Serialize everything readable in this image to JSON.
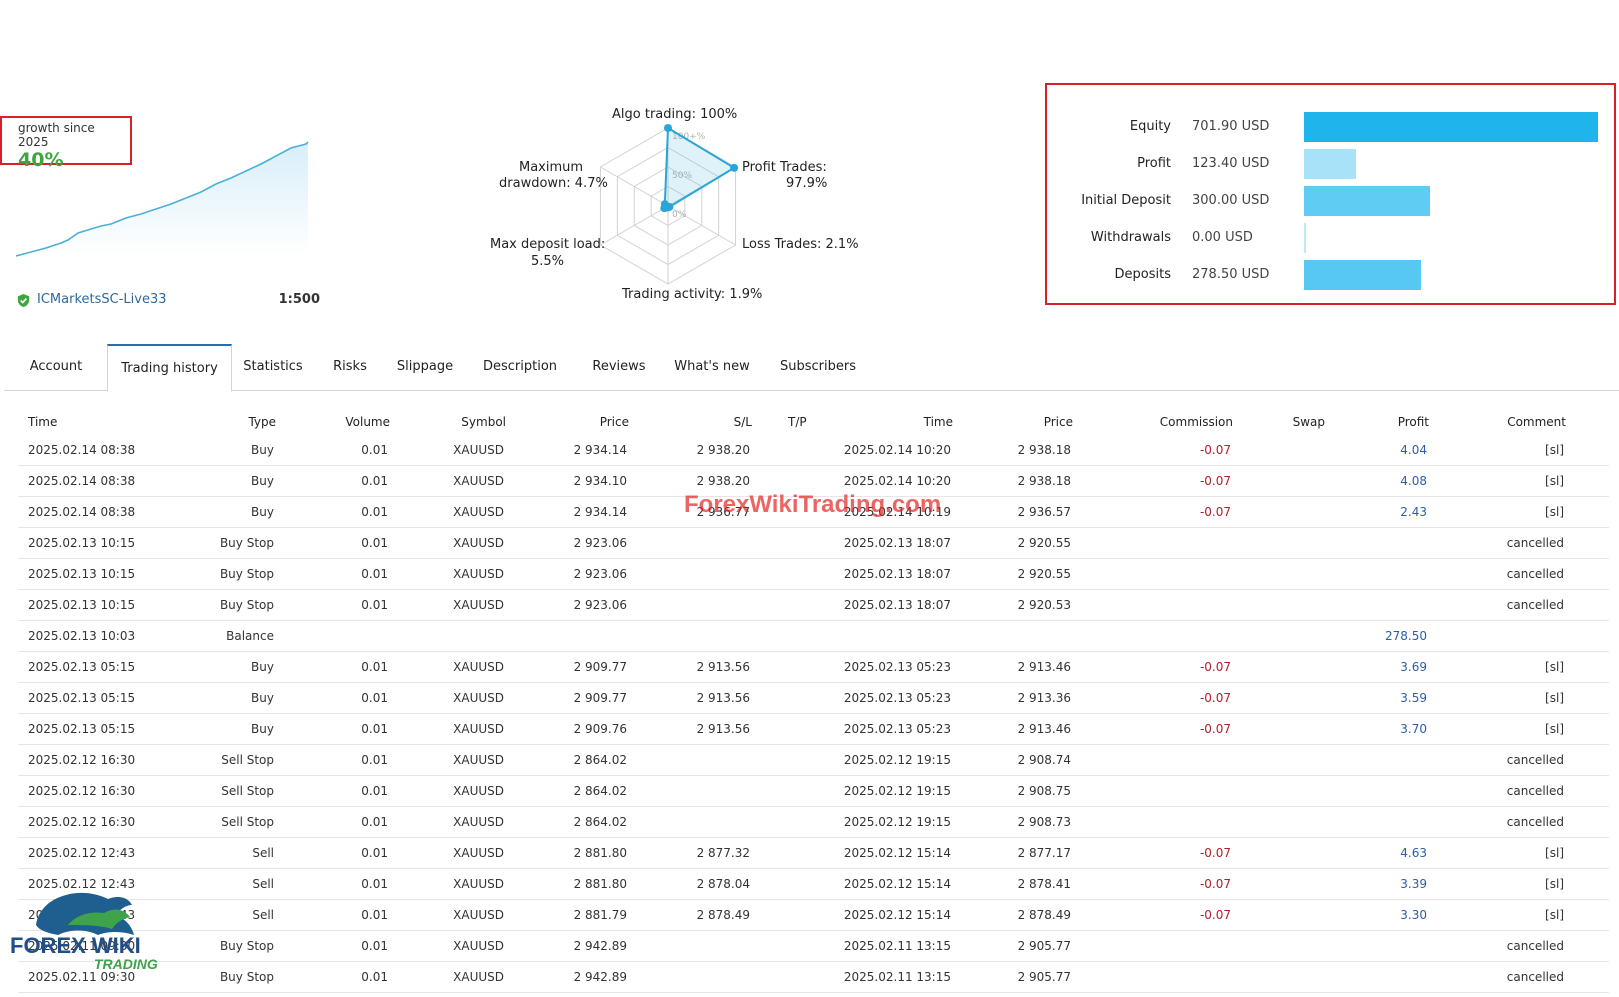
{
  "growth": {
    "label": "growth since 2025",
    "value": "40%",
    "broker": "ICMarketsSC-Live33",
    "leverage": "1:500"
  },
  "radar": {
    "labels": {
      "algo": "Algo trading: 100%",
      "profit_trades": "Profit Trades:",
      "profit_trades_value": "97.9%",
      "loss_trades": "Loss Trades: 2.1%",
      "activity": "Trading activity: 1.9%",
      "deposit_load": "Max deposit load:",
      "deposit_load_value": "5.5%",
      "drawdown": "Maximum",
      "drawdown_value": "drawdown: 4.7%"
    },
    "scale": [
      "100+%",
      "50%",
      "0%"
    ],
    "values": {
      "algo": 100,
      "profit_trades": 97.9,
      "loss_trades": 2.1,
      "activity": 1.9,
      "deposit_load": 5.5,
      "drawdown": 4.7
    },
    "accent": "#29a6d6"
  },
  "balance": {
    "rows": [
      {
        "label": "Equity",
        "value": "701.90 USD",
        "amount": 701.9,
        "color": "#1fb4ec"
      },
      {
        "label": "Profit",
        "value": "123.40 USD",
        "amount": 123.4,
        "color": "#a8e2f8"
      },
      {
        "label": "Initial Deposit",
        "value": "300.00 USD",
        "amount": 300.0,
        "color": "#5fcdf3"
      },
      {
        "label": "Withdrawals",
        "value": "0.00 USD",
        "amount": 0.0,
        "color": "#bfe9f9"
      },
      {
        "label": "Deposits",
        "value": "278.50 USD",
        "amount": 278.5,
        "color": "#57c8f1"
      }
    ]
  },
  "tabs": [
    "Account",
    "Trading history",
    "Statistics",
    "Risks",
    "Slippage",
    "Description",
    "Reviews",
    "What's new",
    "Subscribers"
  ],
  "active_tab": "Trading history",
  "table": {
    "headers": [
      "Time",
      "Type",
      "Volume",
      "Symbol",
      "Price",
      "S/L",
      "T/P",
      "Time",
      "Price",
      "Commission",
      "Swap",
      "Profit",
      "Comment"
    ],
    "rows": [
      [
        "2025.02.14 08:38",
        "Buy",
        "0.01",
        "XAUUSD",
        "2 934.14",
        "2 938.20",
        "",
        "2025.02.14 10:20",
        "2 938.18",
        "-0.07",
        "",
        "4.04",
        "[sl]"
      ],
      [
        "2025.02.14 08:38",
        "Buy",
        "0.01",
        "XAUUSD",
        "2 934.10",
        "2 938.20",
        "",
        "2025.02.14 10:20",
        "2 938.18",
        "-0.07",
        "",
        "4.08",
        "[sl]"
      ],
      [
        "2025.02.14 08:38",
        "Buy",
        "0.01",
        "XAUUSD",
        "2 934.14",
        "2 936.77",
        "",
        "2025.02.14 10:19",
        "2 936.57",
        "-0.07",
        "",
        "2.43",
        "[sl]"
      ],
      [
        "2025.02.13 10:15",
        "Buy Stop",
        "0.01",
        "XAUUSD",
        "2 923.06",
        "",
        "",
        "2025.02.13 18:07",
        "2 920.55",
        "",
        "",
        "",
        "cancelled"
      ],
      [
        "2025.02.13 10:15",
        "Buy Stop",
        "0.01",
        "XAUUSD",
        "2 923.06",
        "",
        "",
        "2025.02.13 18:07",
        "2 920.55",
        "",
        "",
        "",
        "cancelled"
      ],
      [
        "2025.02.13 10:15",
        "Buy Stop",
        "0.01",
        "XAUUSD",
        "2 923.06",
        "",
        "",
        "2025.02.13 18:07",
        "2 920.53",
        "",
        "",
        "",
        "cancelled"
      ],
      [
        "2025.02.13 10:03",
        "Balance",
        "",
        "",
        "",
        "",
        "",
        "",
        "",
        "",
        "",
        "278.50",
        ""
      ],
      [
        "2025.02.13 05:15",
        "Buy",
        "0.01",
        "XAUUSD",
        "2 909.77",
        "2 913.56",
        "",
        "2025.02.13 05:23",
        "2 913.46",
        "-0.07",
        "",
        "3.69",
        "[sl]"
      ],
      [
        "2025.02.13 05:15",
        "Buy",
        "0.01",
        "XAUUSD",
        "2 909.77",
        "2 913.56",
        "",
        "2025.02.13 05:23",
        "2 913.36",
        "-0.07",
        "",
        "3.59",
        "[sl]"
      ],
      [
        "2025.02.13 05:15",
        "Buy",
        "0.01",
        "XAUUSD",
        "2 909.76",
        "2 913.56",
        "",
        "2025.02.13 05:23",
        "2 913.46",
        "-0.07",
        "",
        "3.70",
        "[sl]"
      ],
      [
        "2025.02.12 16:30",
        "Sell Stop",
        "0.01",
        "XAUUSD",
        "2 864.02",
        "",
        "",
        "2025.02.12 19:15",
        "2 908.74",
        "",
        "",
        "",
        "cancelled"
      ],
      [
        "2025.02.12 16:30",
        "Sell Stop",
        "0.01",
        "XAUUSD",
        "2 864.02",
        "",
        "",
        "2025.02.12 19:15",
        "2 908.75",
        "",
        "",
        "",
        "cancelled"
      ],
      [
        "2025.02.12 16:30",
        "Sell Stop",
        "0.01",
        "XAUUSD",
        "2 864.02",
        "",
        "",
        "2025.02.12 19:15",
        "2 908.73",
        "",
        "",
        "",
        "cancelled"
      ],
      [
        "2025.02.12 12:43",
        "Sell",
        "0.01",
        "XAUUSD",
        "2 881.80",
        "2 877.32",
        "",
        "2025.02.12 15:14",
        "2 877.17",
        "-0.07",
        "",
        "4.63",
        "[sl]"
      ],
      [
        "2025.02.12 12:43",
        "Sell",
        "0.01",
        "XAUUSD",
        "2 881.80",
        "2 878.04",
        "",
        "2025.02.12 15:14",
        "2 878.41",
        "-0.07",
        "",
        "3.39",
        "[sl]"
      ],
      [
        "2025.02.12 12:43",
        "Sell",
        "0.01",
        "XAUUSD",
        "2 881.79",
        "2 878.49",
        "",
        "2025.02.12 15:14",
        "2 878.49",
        "-0.07",
        "",
        "3.30",
        "[sl]"
      ],
      [
        "2025.02.11 09:30",
        "Buy Stop",
        "0.01",
        "XAUUSD",
        "2 942.89",
        "",
        "",
        "2025.02.11 13:15",
        "2 905.77",
        "",
        "",
        "",
        "cancelled"
      ],
      [
        "2025.02.11 09:30",
        "Buy Stop",
        "0.01",
        "XAUUSD",
        "2 942.89",
        "",
        "",
        "2025.02.11 13:15",
        "2 905.77",
        "",
        "",
        "",
        "cancelled"
      ]
    ]
  },
  "watermark": "ForexWikiTrading.com",
  "logo": {
    "line1": "FOREX WIKI",
    "line2": "TRADING"
  },
  "colors": {
    "positive": "#2a5ea8",
    "negative": "#b0202a",
    "growth": "#3fa63f",
    "frame": "#d6202a"
  }
}
